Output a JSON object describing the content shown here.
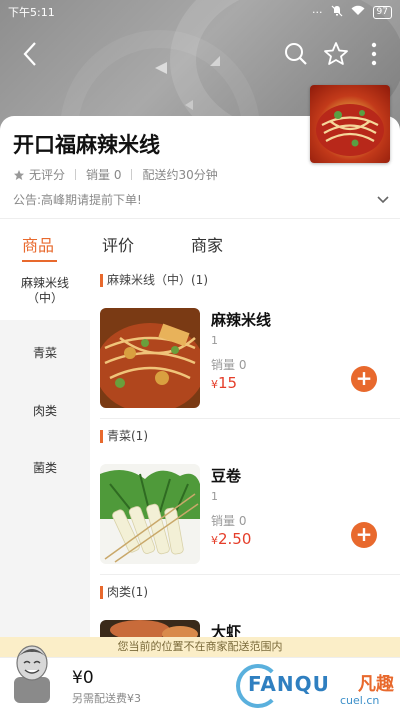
{
  "status_bar": {
    "time": "下午5:11",
    "battery": "97"
  },
  "shop": {
    "name": "开口福麻辣米线",
    "rating": "无评分",
    "sales": "销量 0",
    "delivery_time": "配送约30分钟",
    "notice": "公告:高峰期请提前下单!"
  },
  "tabs": [
    {
      "label": "商品"
    },
    {
      "label": "评价"
    },
    {
      "label": "商家"
    }
  ],
  "sidebar": {
    "items": [
      {
        "label": "麻辣米线（中）"
      },
      {
        "label": "青菜"
      },
      {
        "label": "肉类"
      },
      {
        "label": "菌类"
      }
    ]
  },
  "sections": [
    {
      "title": "麻辣米线（中）(1)",
      "item": {
        "name": "麻辣米线",
        "desc": "1",
        "sales": "销量 0",
        "currency": "¥",
        "price": "15"
      }
    },
    {
      "title": "青菜(1)",
      "item": {
        "name": "豆卷",
        "desc": "1",
        "sales": "销量 0",
        "currency": "¥",
        "price": "2.50"
      }
    },
    {
      "title": "肉类(1)",
      "item": {
        "name": "大虾"
      }
    }
  ],
  "banner": {
    "text": "您当前的位置不在商家配送范围内"
  },
  "cart": {
    "total": "¥0",
    "delivery_fee": "另需配送费¥3"
  },
  "watermark": {
    "brand": "FANQU",
    "brand_cn": "凡趣",
    "url": "cuel.cn"
  },
  "colors": {
    "accent": "#e8692d",
    "price": "#e53e2a",
    "banner": "#fbeec8"
  }
}
